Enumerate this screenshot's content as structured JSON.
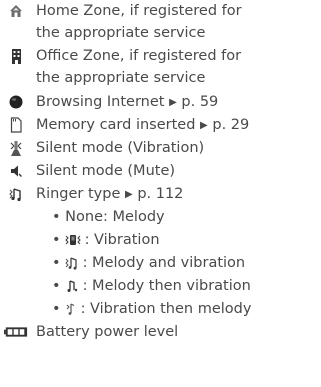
{
  "items": [
    {
      "icon": "home-zone-icon",
      "lines": [
        "Home Zone, if registered for",
        "the appropriate service"
      ]
    },
    {
      "icon": "office-zone-icon",
      "lines": [
        "Office Zone, if registered for",
        "the appropriate service"
      ]
    },
    {
      "icon": "browsing-internet-icon",
      "text": "Browsing Internet",
      "ref": "p. 59"
    },
    {
      "icon": "memory-card-icon",
      "text": "Memory card inserted",
      "ref": "p. 29"
    },
    {
      "icon": "silent-vibration-icon",
      "text": "Silent mode (Vibration)"
    },
    {
      "icon": "silent-mute-icon",
      "text": "Silent mode (Mute)"
    },
    {
      "icon": "ringer-type-icon",
      "text": "Ringer type",
      "ref": "p. 112"
    }
  ],
  "ringer_options": [
    {
      "icon": "",
      "text": "None: Melody"
    },
    {
      "icon": "vibration-icon",
      "text": ": Vibration"
    },
    {
      "icon": "melody-and-vibration-icon",
      "text": ": Melody and vibration"
    },
    {
      "icon": "melody-then-vibration-icon",
      "text": ": Melody then vibration"
    },
    {
      "icon": "vibration-then-melody-icon",
      "text": ": Vibration then melody"
    }
  ],
  "battery": {
    "icon": "battery-icon",
    "text": "Battery power level"
  },
  "glyphs": {
    "bullet": "•",
    "pointer": "▶"
  },
  "colors": {
    "text": "#4a4a4a",
    "icon": "#333333"
  }
}
